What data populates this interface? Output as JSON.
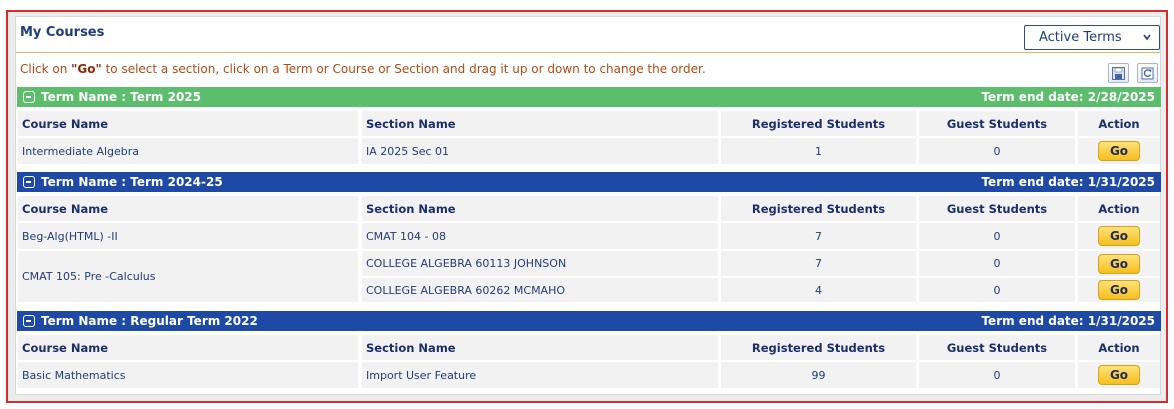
{
  "page": {
    "title": "My Courses"
  },
  "terms_select": {
    "value": "Active Terms"
  },
  "instructions": {
    "before": "Click on ",
    "go_word": "\"Go\"",
    "after": " to select a section, click on a Term or Course or Section and drag it up or down to change the order."
  },
  "columns": {
    "course": "Course Name",
    "section": "Section Name",
    "registered": "Registered Students",
    "guest": "Guest Students",
    "action": "Action"
  },
  "go_label": "Go",
  "colors": {
    "term_green": "#5cbd6c",
    "term_blue": "#1e4aa6",
    "border_red": "#d92b2b"
  },
  "terms": [
    {
      "name": "Term Name : Term 2025",
      "end": "Term end date: 2/28/2025",
      "rows": [
        {
          "course": "Intermediate Algebra",
          "section": "IA 2025 Sec 01",
          "registered": "1",
          "guest": "0"
        }
      ]
    },
    {
      "name": "Term Name : Term 2024-25",
      "end": "Term end date: 1/31/2025",
      "rows": [
        {
          "course": "Beg-Alg(HTML) -II",
          "section": "CMAT 104 - 08",
          "registered": "7",
          "guest": "0"
        },
        {
          "course": "CMAT 105: Pre -Calculus",
          "section": "COLLEGE ALGEBRA 60113 JOHNSON",
          "registered": "7",
          "guest": "0"
        },
        {
          "course": "",
          "section": "COLLEGE ALGEBRA 60262 MCMAHO",
          "registered": "4",
          "guest": "0"
        }
      ]
    },
    {
      "name": "Term Name : Regular Term 2022",
      "end": "Term end date: 1/31/2025",
      "rows": [
        {
          "course": "Basic Mathematics",
          "section": "Import User Feature",
          "registered": "99",
          "guest": "0"
        }
      ]
    }
  ]
}
